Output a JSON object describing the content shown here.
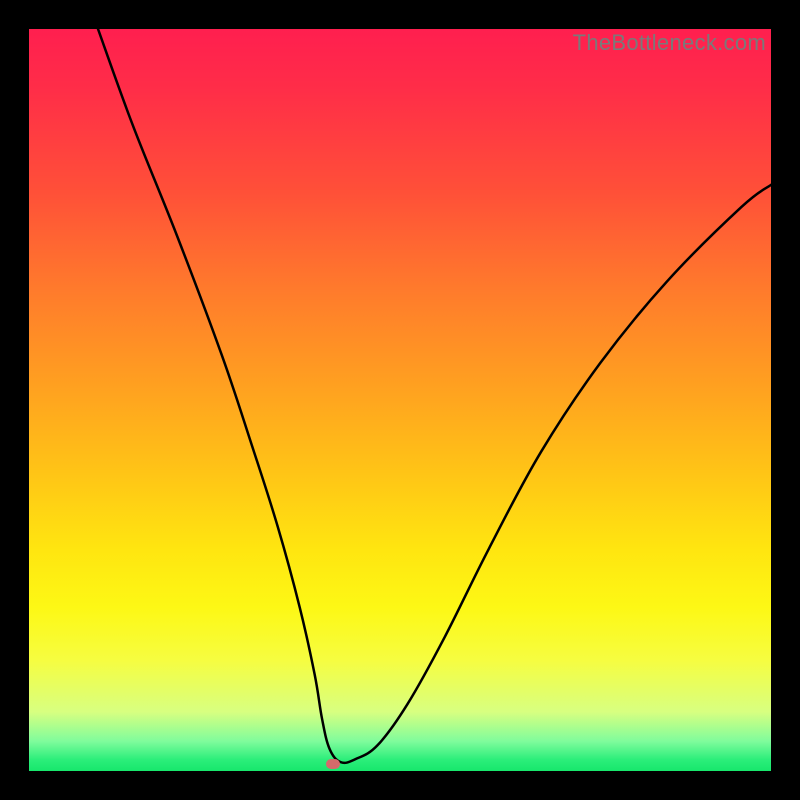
{
  "watermark": "TheBottleneck.com",
  "chart_data": {
    "type": "line",
    "title": "",
    "xlabel": "",
    "ylabel": "",
    "xlim": [
      0,
      100
    ],
    "ylim": [
      0,
      100
    ],
    "grid": false,
    "series": [
      {
        "name": "bottleneck-curve",
        "x": [
          9.3,
          14,
          20,
          26,
          30,
          33.5,
          36.5,
          38.5,
          39.5,
          40.5,
          42,
          44,
          47,
          51,
          56,
          62,
          69,
          77,
          86,
          96,
          100
        ],
        "y": [
          100,
          87,
          72,
          56,
          44,
          33,
          22,
          13,
          7,
          3,
          1.2,
          1.6,
          3.5,
          9,
          18,
          30,
          43,
          55,
          66,
          76,
          79
        ]
      }
    ],
    "marker": {
      "x": 41,
      "y": 1.0,
      "color": "#d46a6b"
    },
    "gradient_background": {
      "top": "#ff1f4f",
      "middle": "#ffe510",
      "bottom": "#17e76c"
    }
  }
}
